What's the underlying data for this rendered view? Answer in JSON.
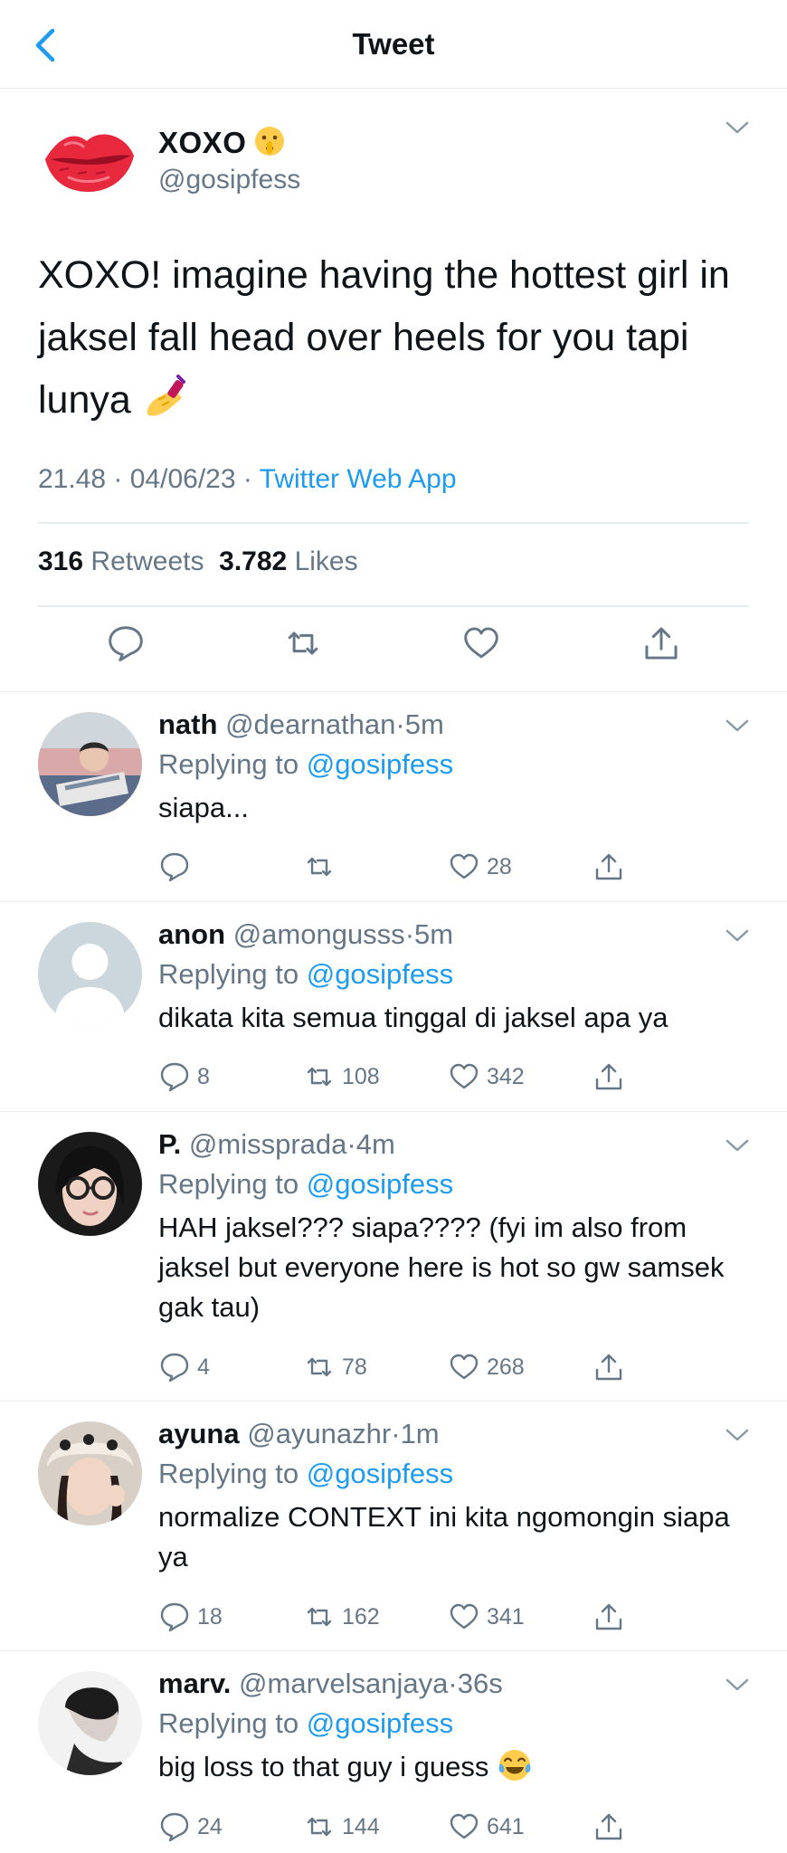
{
  "header": {
    "title": "Tweet"
  },
  "main": {
    "name": "XOXO",
    "handle": "@gosipfess",
    "text": "XOXO! imagine having the hottest girl in jaksel fall head over heels for you tapi lunya",
    "time": "21.48",
    "date": "04/06/23",
    "source": "Twitter Web App",
    "retweets": "316",
    "retweets_label": "Retweets",
    "likes": "3.782",
    "likes_label": "Likes",
    "icons": {
      "name_emoji": "shushing-face-emoji",
      "text_emoji": "nail-polish-emoji"
    }
  },
  "replying_label": "Replying to",
  "replying_to": "@gosipfess",
  "replies": [
    {
      "name": "nath",
      "handle": "@dearnathan",
      "time": "5m",
      "text": "siapa...",
      "replies": "",
      "retweets": "",
      "likes": "28"
    },
    {
      "name": "anon",
      "handle": "@amongusss",
      "time": "5m",
      "text": "dikata kita semua tinggal di jaksel apa ya",
      "replies": "8",
      "retweets": "108",
      "likes": "342"
    },
    {
      "name": "P.",
      "handle": "@missprada",
      "time": "4m",
      "text": "HAH jaksel??? siapa???? (fyi im also from jaksel but everyone here is hot so gw samsek gak tau)",
      "replies": "4",
      "retweets": "78",
      "likes": "268"
    },
    {
      "name": "ayuna",
      "handle": "@ayunazhr",
      "time": "1m",
      "text": "normalize CONTEXT ini kita ngomongin siapa ya",
      "replies": "18",
      "retweets": "162",
      "likes": "341"
    },
    {
      "name": "marv.",
      "handle": "@marvelsanjaya",
      "time": "36s",
      "text": "big loss to that guy i guess",
      "replies": "24",
      "retweets": "144",
      "likes": "641"
    }
  ],
  "colors": {
    "accent": "#1d9bf0",
    "secondary_text": "#657786",
    "divider": "#e6ecf0"
  }
}
